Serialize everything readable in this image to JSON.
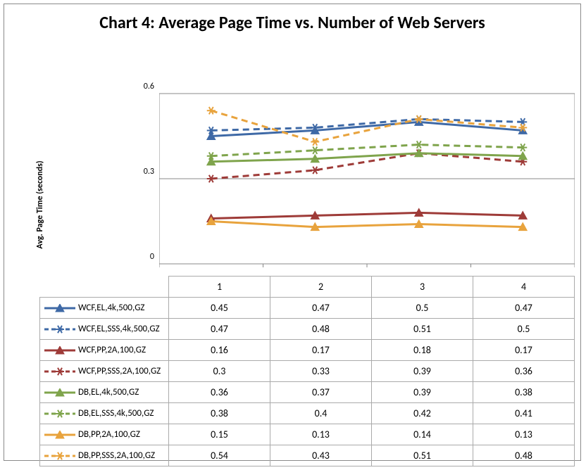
{
  "chart_data": {
    "type": "line",
    "title": "Chart 4: Average Page Time vs. Number of Web Servers",
    "ylabel": "Avg. Page Time (seconds)",
    "xlabel": "",
    "categories": [
      "1",
      "2",
      "3",
      "4"
    ],
    "ylim": [
      0,
      0.6
    ],
    "yticks": [
      "0",
      "0.3",
      "0.6"
    ],
    "series": [
      {
        "name": "WCF,EL,4k,500,GZ",
        "values": [
          0.45,
          0.47,
          0.5,
          0.47
        ],
        "color": "#3E69A6",
        "dash": "solid",
        "marker": "triangle"
      },
      {
        "name": "WCF,EL,SSS,4k,500,GZ",
        "values": [
          0.47,
          0.48,
          0.51,
          0.5
        ],
        "color": "#3E69A6",
        "dash": "dashed",
        "marker": "star"
      },
      {
        "name": "WCF,PP,2A,100,GZ",
        "values": [
          0.16,
          0.17,
          0.18,
          0.17
        ],
        "color": "#9E3B38",
        "dash": "solid",
        "marker": "triangle"
      },
      {
        "name": "WCF,PP,SSS,2A,100,GZ",
        "values": [
          0.3,
          0.33,
          0.39,
          0.36
        ],
        "color": "#9E3B38",
        "dash": "dashed",
        "marker": "star"
      },
      {
        "name": "DB,EL,4k,500,GZ",
        "values": [
          0.36,
          0.37,
          0.39,
          0.38
        ],
        "color": "#7FA44C",
        "dash": "solid",
        "marker": "triangle"
      },
      {
        "name": "DB,EL,SSS,4k,500,GZ",
        "values": [
          0.38,
          0.4,
          0.42,
          0.41
        ],
        "color": "#7FA44C",
        "dash": "dashed",
        "marker": "star"
      },
      {
        "name": "DB,PP,2A,100,GZ",
        "values": [
          0.15,
          0.13,
          0.14,
          0.13
        ],
        "color": "#E8A33D",
        "dash": "solid",
        "marker": "triangle"
      },
      {
        "name": "DB,PP,SSS,2A,100,GZ",
        "values": [
          0.54,
          0.43,
          0.51,
          0.48
        ],
        "color": "#E8A33D",
        "dash": "dashed",
        "marker": "star"
      }
    ]
  }
}
